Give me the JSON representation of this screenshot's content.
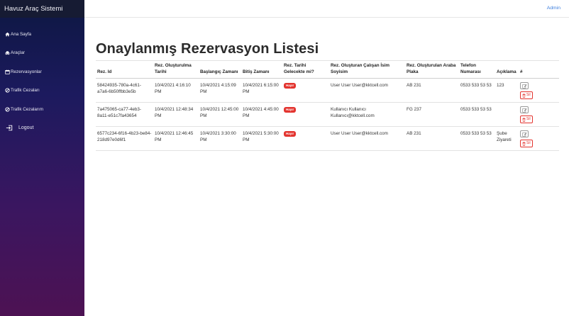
{
  "brand": "Havuz Araç Sistemi",
  "nav": [
    {
      "label": "Ana Sayfa",
      "icon": "home-icon"
    },
    {
      "label": "Araçlar",
      "icon": "car-icon"
    },
    {
      "label": "Rezervasyonlar",
      "icon": "calendar-icon"
    },
    {
      "label": "Trafik Cezaları",
      "icon": "restricted-icon"
    },
    {
      "label": "Trafik Cezalarım",
      "icon": "restricted-icon"
    },
    {
      "label": "Logout",
      "icon": "logout-icon"
    }
  ],
  "topbar": {
    "user": "Admin"
  },
  "page": {
    "title": "Onaylanmış Rezervasyon Listesi"
  },
  "table": {
    "headers": {
      "id": "Rez. Id",
      "created": "Rez. Oluşturulma Tarihi",
      "start": "Başlangıç Zamanı",
      "end": "Bitiş Zamanı",
      "future": "Rez. Tarihi Gelecekte mi?",
      "employee": "Rez. Oluşturan Çalışan İsim Soyisim",
      "plate": "Rez. Oluşturulan Araba Plaka",
      "phone": "Telefon Numarası",
      "desc": "Açıklama",
      "hash": "#"
    },
    "rows": [
      {
        "id": "58424935-780a-4c61-a7a6-6b50ffbb3e5b",
        "created": "10/4/2021 4:16:10 PM",
        "start": "10/4/2021 4:15:09 PM",
        "end": "10/4/2021 6:15:00 PM",
        "future": "Hayır",
        "employee": "User User User@kktcell.com",
        "plate": "AB 231",
        "phone": "0533 533 53 53",
        "desc": "123"
      },
      {
        "id": "7a475065-ca77-4eb3-8a11-e51c7fa43654",
        "created": "10/4/2021 12:48:34 PM",
        "start": "10/4/2021 12:45:00 PM",
        "end": "10/4/2021 4:45:00 PM",
        "future": "Hayır",
        "employee": "Kullanıcı Kullanıcı Kullanıcı@kktcell.com",
        "plate": "FG 237",
        "phone": "0533 533 53 53",
        "desc": ""
      },
      {
        "id": "6577c234-6f16-4b23-be84-218d97e0d6f1",
        "created": "10/4/2021 12:46:45 PM",
        "start": "10/4/2021 3:30:00 PM",
        "end": "10/4/2021 5:30:00 PM",
        "future": "Hayır",
        "employee": "User User User@kktcell.com",
        "plate": "AB 231",
        "phone": "0533 533 53 53",
        "desc": "Şube Ziyareti"
      }
    ],
    "delete_label": "Sil"
  },
  "colors": {
    "accent": "#3b7ddd",
    "danger": "#e3342f",
    "sidebar_top": "#0d1742",
    "sidebar_bottom": "#4d1253"
  }
}
